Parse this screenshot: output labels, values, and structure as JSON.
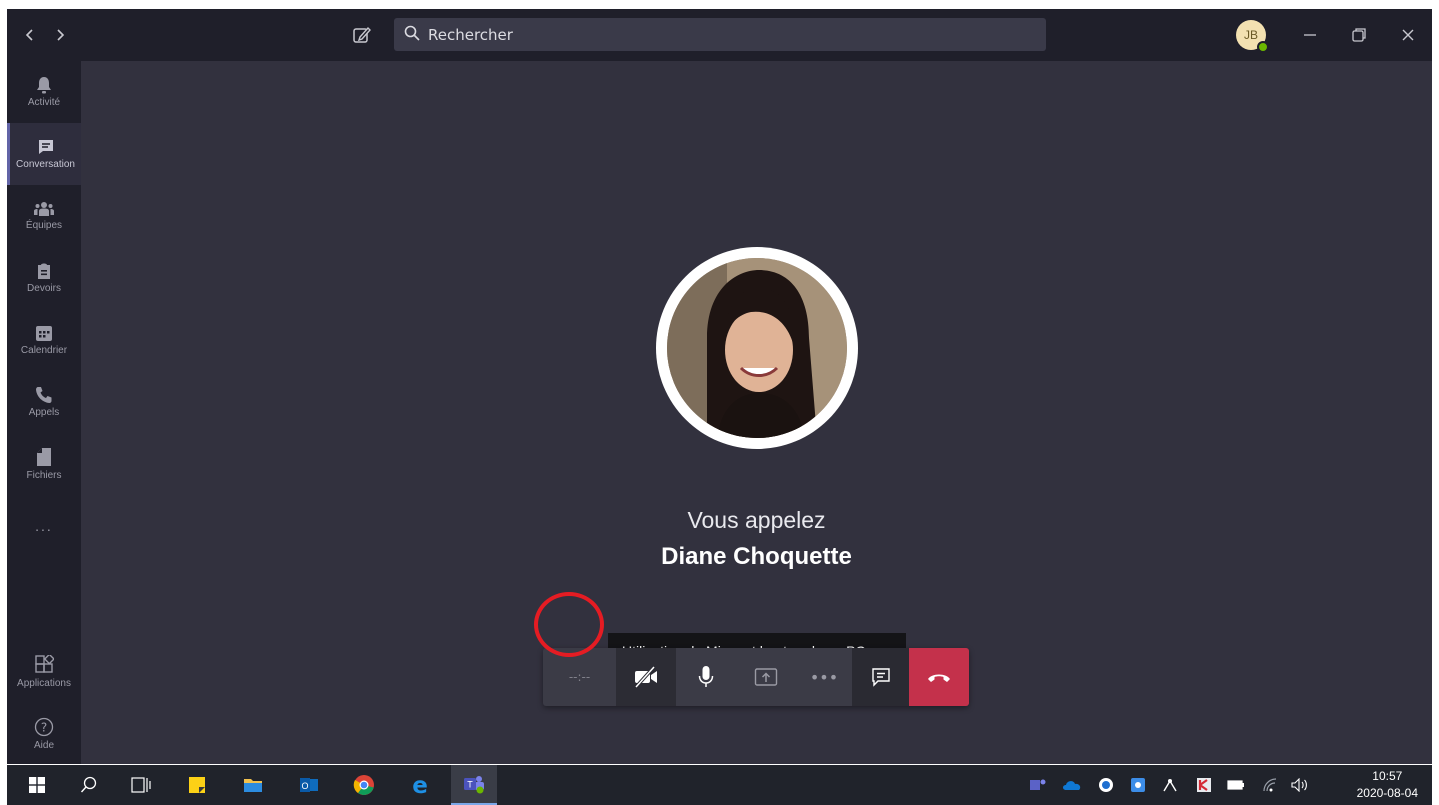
{
  "search": {
    "placeholder": "Rechercher"
  },
  "user": {
    "initials": "JB"
  },
  "rail": {
    "items": [
      {
        "label": "Activité",
        "icon": "bell-icon"
      },
      {
        "label": "Conversation",
        "icon": "chat-icon"
      },
      {
        "label": "Équipes",
        "icon": "teams-icon"
      },
      {
        "label": "Devoirs",
        "icon": "assignments-icon"
      },
      {
        "label": "Calendrier",
        "icon": "calendar-icon"
      },
      {
        "label": "Appels",
        "icon": "phone-icon"
      },
      {
        "label": "Fichiers",
        "icon": "files-icon"
      },
      {
        "label": "...",
        "icon": "more-icon"
      }
    ],
    "bottom": [
      {
        "label": "Applications",
        "icon": "apps-icon"
      },
      {
        "label": "Aide",
        "icon": "help-icon"
      }
    ]
  },
  "call": {
    "status": "Vous appelez",
    "callee": "Diane Choquette",
    "tooltip": "Utilisation de Micro et haut-parleurs PC",
    "timer": "--:--",
    "more": "•••"
  },
  "taskbar": {
    "time": "10:57",
    "date": "2020-08-04"
  },
  "colors": {
    "accent": "#6264a7",
    "hangup": "#c4314b",
    "highlight_circle": "#e51c23",
    "presence": "#6bb700"
  }
}
